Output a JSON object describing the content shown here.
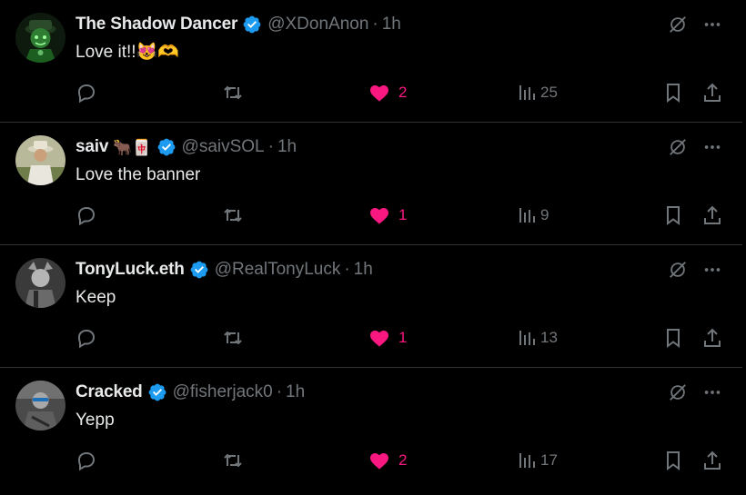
{
  "colors": {
    "background": "#000000",
    "text": "#e7e9ea",
    "muted": "#71767b",
    "like": "#f91880",
    "verified": "#1d9bf0",
    "divider": "#2f3336"
  },
  "replies": [
    {
      "name": "The Shadow Dancer",
      "badges": "",
      "handle": "@XDonAnon",
      "time": "1h",
      "text": "Love it!!😻🫶",
      "likes": "2",
      "views": "25",
      "liked": true,
      "avatar_icon": "green-character-avatar"
    },
    {
      "name": "saiv",
      "badges": "🐂🀄",
      "handle": "@saivSOL",
      "time": "1h",
      "text": "Love the banner",
      "likes": "1",
      "views": "9",
      "liked": true,
      "avatar_icon": "person-with-hat-avatar"
    },
    {
      "name": "TonyLuck.eth",
      "badges": "",
      "handle": "@RealTonyLuck",
      "time": "1h",
      "text": "Keep",
      "likes": "1",
      "views": "13",
      "liked": true,
      "avatar_icon": "grayscale-portrait-avatar"
    },
    {
      "name": "Cracked",
      "badges": "",
      "handle": "@fisherjack0",
      "time": "1h",
      "text": "Yepp",
      "likes": "2",
      "views": "17",
      "liked": true,
      "avatar_icon": "grayscale-person-sunglasses-avatar"
    }
  ],
  "separator": "·"
}
